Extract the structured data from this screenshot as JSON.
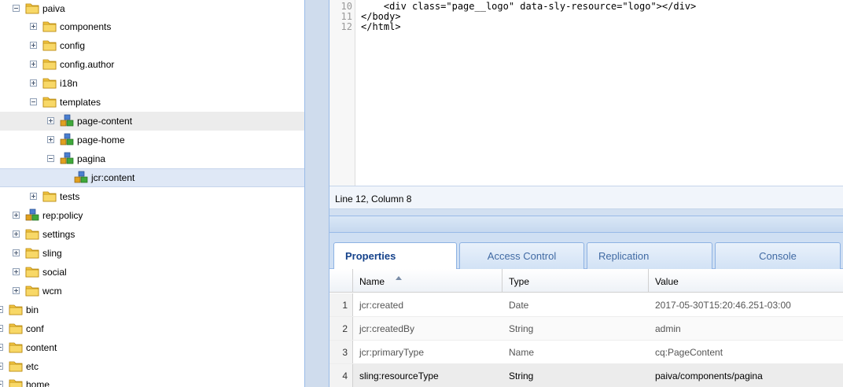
{
  "tree": {
    "nodes": [
      {
        "label": "paiva",
        "icon": "folder-icon",
        "toggle": "minus"
      },
      {
        "label": "components",
        "icon": "folder-icon",
        "toggle": "plus"
      },
      {
        "label": "config",
        "icon": "folder-icon",
        "toggle": "plus"
      },
      {
        "label": "config.author",
        "icon": "folder-icon",
        "toggle": "plus"
      },
      {
        "label": "i18n",
        "icon": "folder-icon",
        "toggle": "plus"
      },
      {
        "label": "templates",
        "icon": "folder-icon",
        "toggle": "minus"
      },
      {
        "label": "page-content",
        "icon": "node-icon",
        "toggle": "plus"
      },
      {
        "label": "page-home",
        "icon": "node-icon",
        "toggle": "plus"
      },
      {
        "label": "pagina",
        "icon": "node-icon",
        "toggle": "minus"
      },
      {
        "label": "jcr:content",
        "icon": "node-icon",
        "toggle": "none"
      },
      {
        "label": "tests",
        "icon": "folder-icon",
        "toggle": "plus"
      },
      {
        "label": "rep:policy",
        "icon": "node-icon",
        "toggle": "plus"
      },
      {
        "label": "settings",
        "icon": "folder-icon",
        "toggle": "plus"
      },
      {
        "label": "sling",
        "icon": "folder-icon",
        "toggle": "plus"
      },
      {
        "label": "social",
        "icon": "folder-icon",
        "toggle": "plus"
      },
      {
        "label": "wcm",
        "icon": "folder-icon",
        "toggle": "plus"
      },
      {
        "label": "bin",
        "icon": "folder-icon",
        "toggle": "plus"
      },
      {
        "label": "conf",
        "icon": "folder-icon",
        "toggle": "plus"
      },
      {
        "label": "content",
        "icon": "folder-icon",
        "toggle": "plus"
      },
      {
        "label": "etc",
        "icon": "folder-icon",
        "toggle": "plus"
      },
      {
        "label": "home",
        "icon": "folder-icon",
        "toggle": "plus"
      }
    ]
  },
  "editor": {
    "lines": [
      {
        "num": "10",
        "text": "    <div class=\"page__logo\" data-sly-resource=\"logo\"></div>"
      },
      {
        "num": "11",
        "text": "</body>"
      },
      {
        "num": "12",
        "text": "</html>"
      }
    ],
    "status": "Line 12, Column 8"
  },
  "tabs": [
    "Properties",
    "Access Control",
    "Replication",
    "Console"
  ],
  "grid": {
    "columns": [
      "Name",
      "Type",
      "Value"
    ],
    "rows": [
      {
        "num": "1",
        "name": "jcr:created",
        "type": "Date",
        "value": "2017-05-30T15:20:46.251-03:00"
      },
      {
        "num": "2",
        "name": "jcr:createdBy",
        "type": "String",
        "value": "admin"
      },
      {
        "num": "3",
        "name": "jcr:primaryType",
        "type": "Name",
        "value": "cq:PageContent"
      },
      {
        "num": "4",
        "name": "sling:resourceType",
        "type": "String",
        "value": "paiva/components/pagina"
      }
    ]
  },
  "colors": {
    "accent": "#15428b",
    "selection": "#dfe8f6",
    "folder": "#f3c542",
    "panel": "#cfdff3"
  }
}
